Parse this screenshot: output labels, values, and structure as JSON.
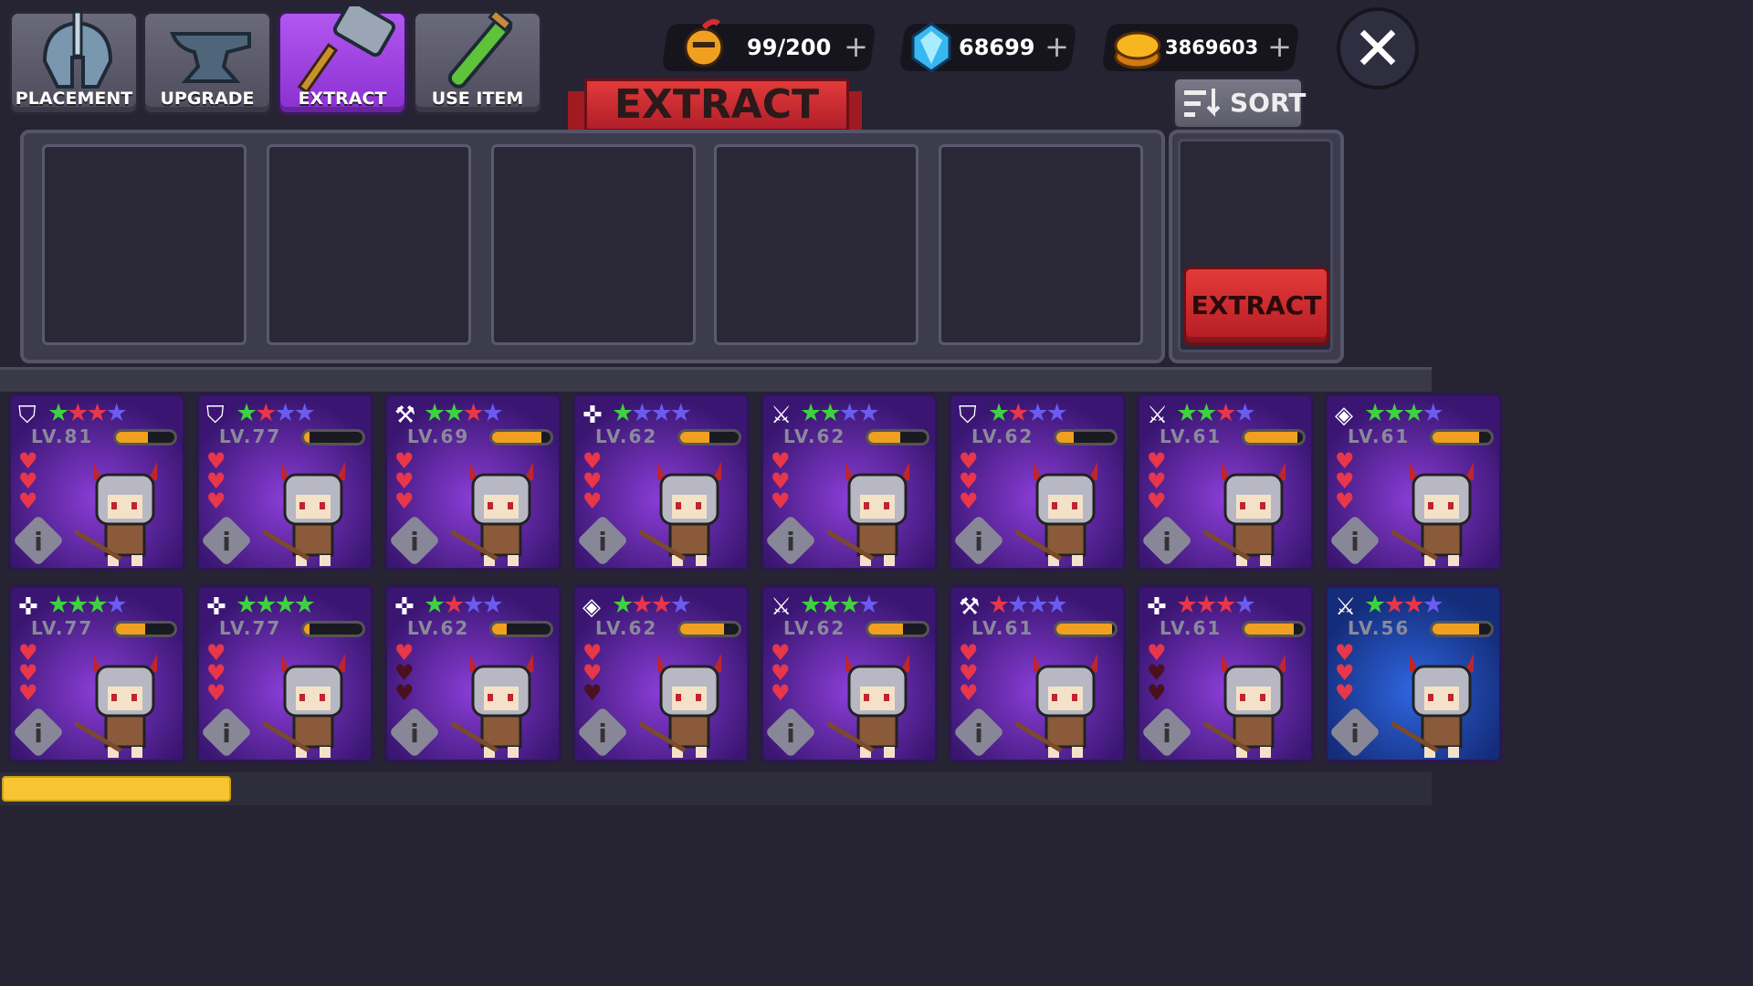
{
  "tabs": [
    {
      "label": "PLACEMENT",
      "icon": "helmet-icon",
      "active": false
    },
    {
      "label": "UPGRADE",
      "icon": "anvil-icon",
      "active": false
    },
    {
      "label": "EXTRACT",
      "icon": "hammer-icon",
      "active": true
    },
    {
      "label": "USE ITEM",
      "icon": "potion-icon",
      "active": false
    }
  ],
  "resources": {
    "heroes": "99/200",
    "gems": "68699",
    "gold": "3869603",
    "plus": "+"
  },
  "close_label": "✕",
  "banner_title": "EXTRACT",
  "sort_label": "SORT",
  "extract_button": "EXTRACT",
  "info_glyph": "i",
  "colors": {
    "accent": "#a63ee8",
    "red": "#d92c32",
    "gold": "#f7c531"
  },
  "progress_value": 0.16,
  "heroes": [
    {
      "class": "⛉",
      "stars": [
        "g",
        "r",
        "r",
        "b"
      ],
      "level": "LV.81",
      "hp": 3,
      "bar": 0.55
    },
    {
      "class": "⛉",
      "stars": [
        "g",
        "r",
        "b",
        "b"
      ],
      "level": "LV.77",
      "hp": 3,
      "bar": 0.1
    },
    {
      "class": "⚒",
      "stars": [
        "g",
        "g",
        "r",
        "b"
      ],
      "level": "LV.69",
      "hp": 3,
      "bar": 0.85
    },
    {
      "class": "✜",
      "stars": [
        "g",
        "b",
        "b",
        "b"
      ],
      "level": "LV.62",
      "hp": 3,
      "bar": 0.5
    },
    {
      "class": "⚔",
      "stars": [
        "g",
        "g",
        "b",
        "b"
      ],
      "level": "LV.62",
      "hp": 3,
      "bar": 0.55
    },
    {
      "class": "⛉",
      "stars": [
        "g",
        "r",
        "b",
        "b"
      ],
      "level": "LV.62",
      "hp": 3,
      "bar": 0.3
    },
    {
      "class": "⚔",
      "stars": [
        "g",
        "g",
        "r",
        "b"
      ],
      "level": "LV.61",
      "hp": 3,
      "bar": 0.9
    },
    {
      "class": "◈",
      "stars": [
        "g",
        "g",
        "g",
        "b"
      ],
      "level": "LV.61",
      "hp": 3,
      "bar": 0.8
    },
    {
      "class": "✜",
      "stars": [
        "g",
        "g",
        "g",
        "b"
      ],
      "level": "LV.77",
      "hp": 3,
      "bar": 0.5
    },
    {
      "class": "✜",
      "stars": [
        "g",
        "g",
        "g",
        "g"
      ],
      "level": "LV.77",
      "hp": 3,
      "bar": 0.1
    },
    {
      "class": "✜",
      "stars": [
        "g",
        "r",
        "b",
        "b"
      ],
      "level": "LV.62",
      "hp": 1,
      "bar": 0.25
    },
    {
      "class": "◈",
      "stars": [
        "g",
        "r",
        "r",
        "b"
      ],
      "level": "LV.62",
      "hp": 2,
      "bar": 0.75
    },
    {
      "class": "⚔",
      "stars": [
        "g",
        "g",
        "g",
        "b"
      ],
      "level": "LV.62",
      "hp": 3,
      "bar": 0.6
    },
    {
      "class": "⚒",
      "stars": [
        "r",
        "b",
        "b",
        "b"
      ],
      "level": "LV.61",
      "hp": 3,
      "bar": 0.95
    },
    {
      "class": "✜",
      "stars": [
        "r",
        "r",
        "r",
        "b"
      ],
      "level": "LV.61",
      "hp": 1,
      "bar": 0.85
    },
    {
      "class": "⚔",
      "stars": [
        "g",
        "r",
        "r",
        "b"
      ],
      "level": "LV.56",
      "hp": 3,
      "bar": 0.8,
      "blue": true
    }
  ]
}
